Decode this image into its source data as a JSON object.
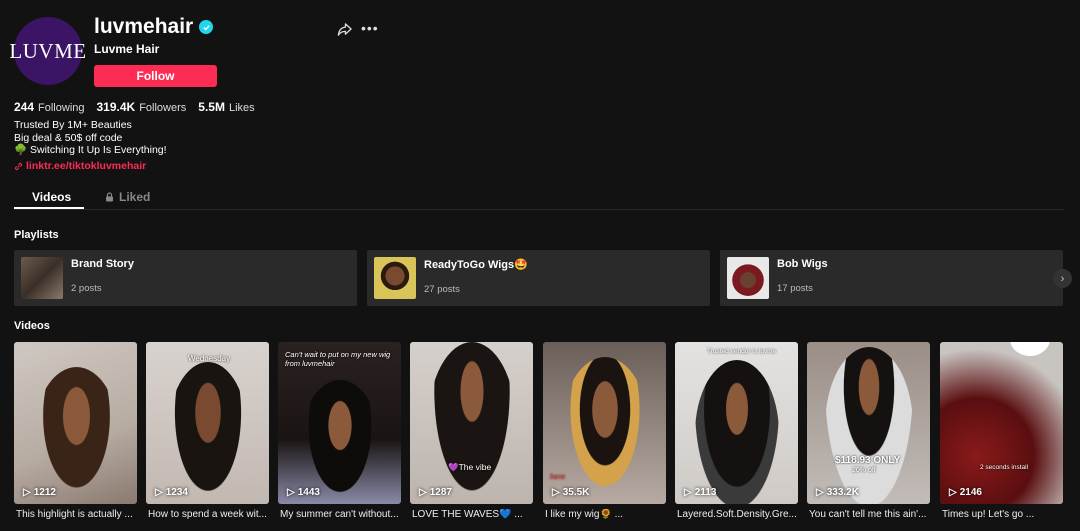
{
  "profile": {
    "avatar_text": "LUVME",
    "username": "luvmehair",
    "display_name": "Luvme Hair",
    "follow_label": "Follow",
    "stats": [
      {
        "value": "244",
        "label": "Following"
      },
      {
        "value": "319.4K",
        "label": "Followers"
      },
      {
        "value": "5.5M",
        "label": "Likes"
      }
    ],
    "bio_lines": [
      "Trusted By 1M+ Beauties",
      "Big deal & 50$ off code",
      "🌳 Switching It Up Is Everything!"
    ],
    "link": "linktr.ee/tiktokluvmehair"
  },
  "tabs": {
    "videos": "Videos",
    "liked": "Liked"
  },
  "sections": {
    "playlists": "Playlists",
    "videos": "Videos"
  },
  "playlists": [
    {
      "name": "Brand Story",
      "count": "2 posts"
    },
    {
      "name": "ReadyToGo Wigs🤩",
      "count": "27 posts"
    },
    {
      "name": "Bob Wigs",
      "count": "17 posts"
    }
  ],
  "videos": [
    {
      "views": "1212",
      "caption": "This highlight is actually ..."
    },
    {
      "views": "1234",
      "caption": "How to spend a week wit...",
      "overlay": "Wednesday"
    },
    {
      "views": "1443",
      "caption": "My summer can't without...",
      "overlay": "Can't wait to put on my new wig from luvmehair"
    },
    {
      "views": "1287",
      "caption": "LOVE THE WAVES💙 ...",
      "overlay": "💜The vibe"
    },
    {
      "views": "35.5K",
      "caption": "I like my wig🌻 ...",
      "overlay": "here"
    },
    {
      "views": "2113",
      "caption": "Layered.Soft.Density.Gre...",
      "overlay": "Trusted vendor is luvme"
    },
    {
      "views": "333.2K",
      "caption": "You can't tell me this ain'...",
      "overlay": "$118.93 ONLY",
      "overlay2": "20% off"
    },
    {
      "views": "2146",
      "caption": "Times up! Let's go ...",
      "overlay": "2 seconds install"
    }
  ],
  "colors": {
    "accent": "#fe2c55",
    "background": "#121212",
    "card": "#2a2a2a",
    "verified": "#20d5ec"
  }
}
